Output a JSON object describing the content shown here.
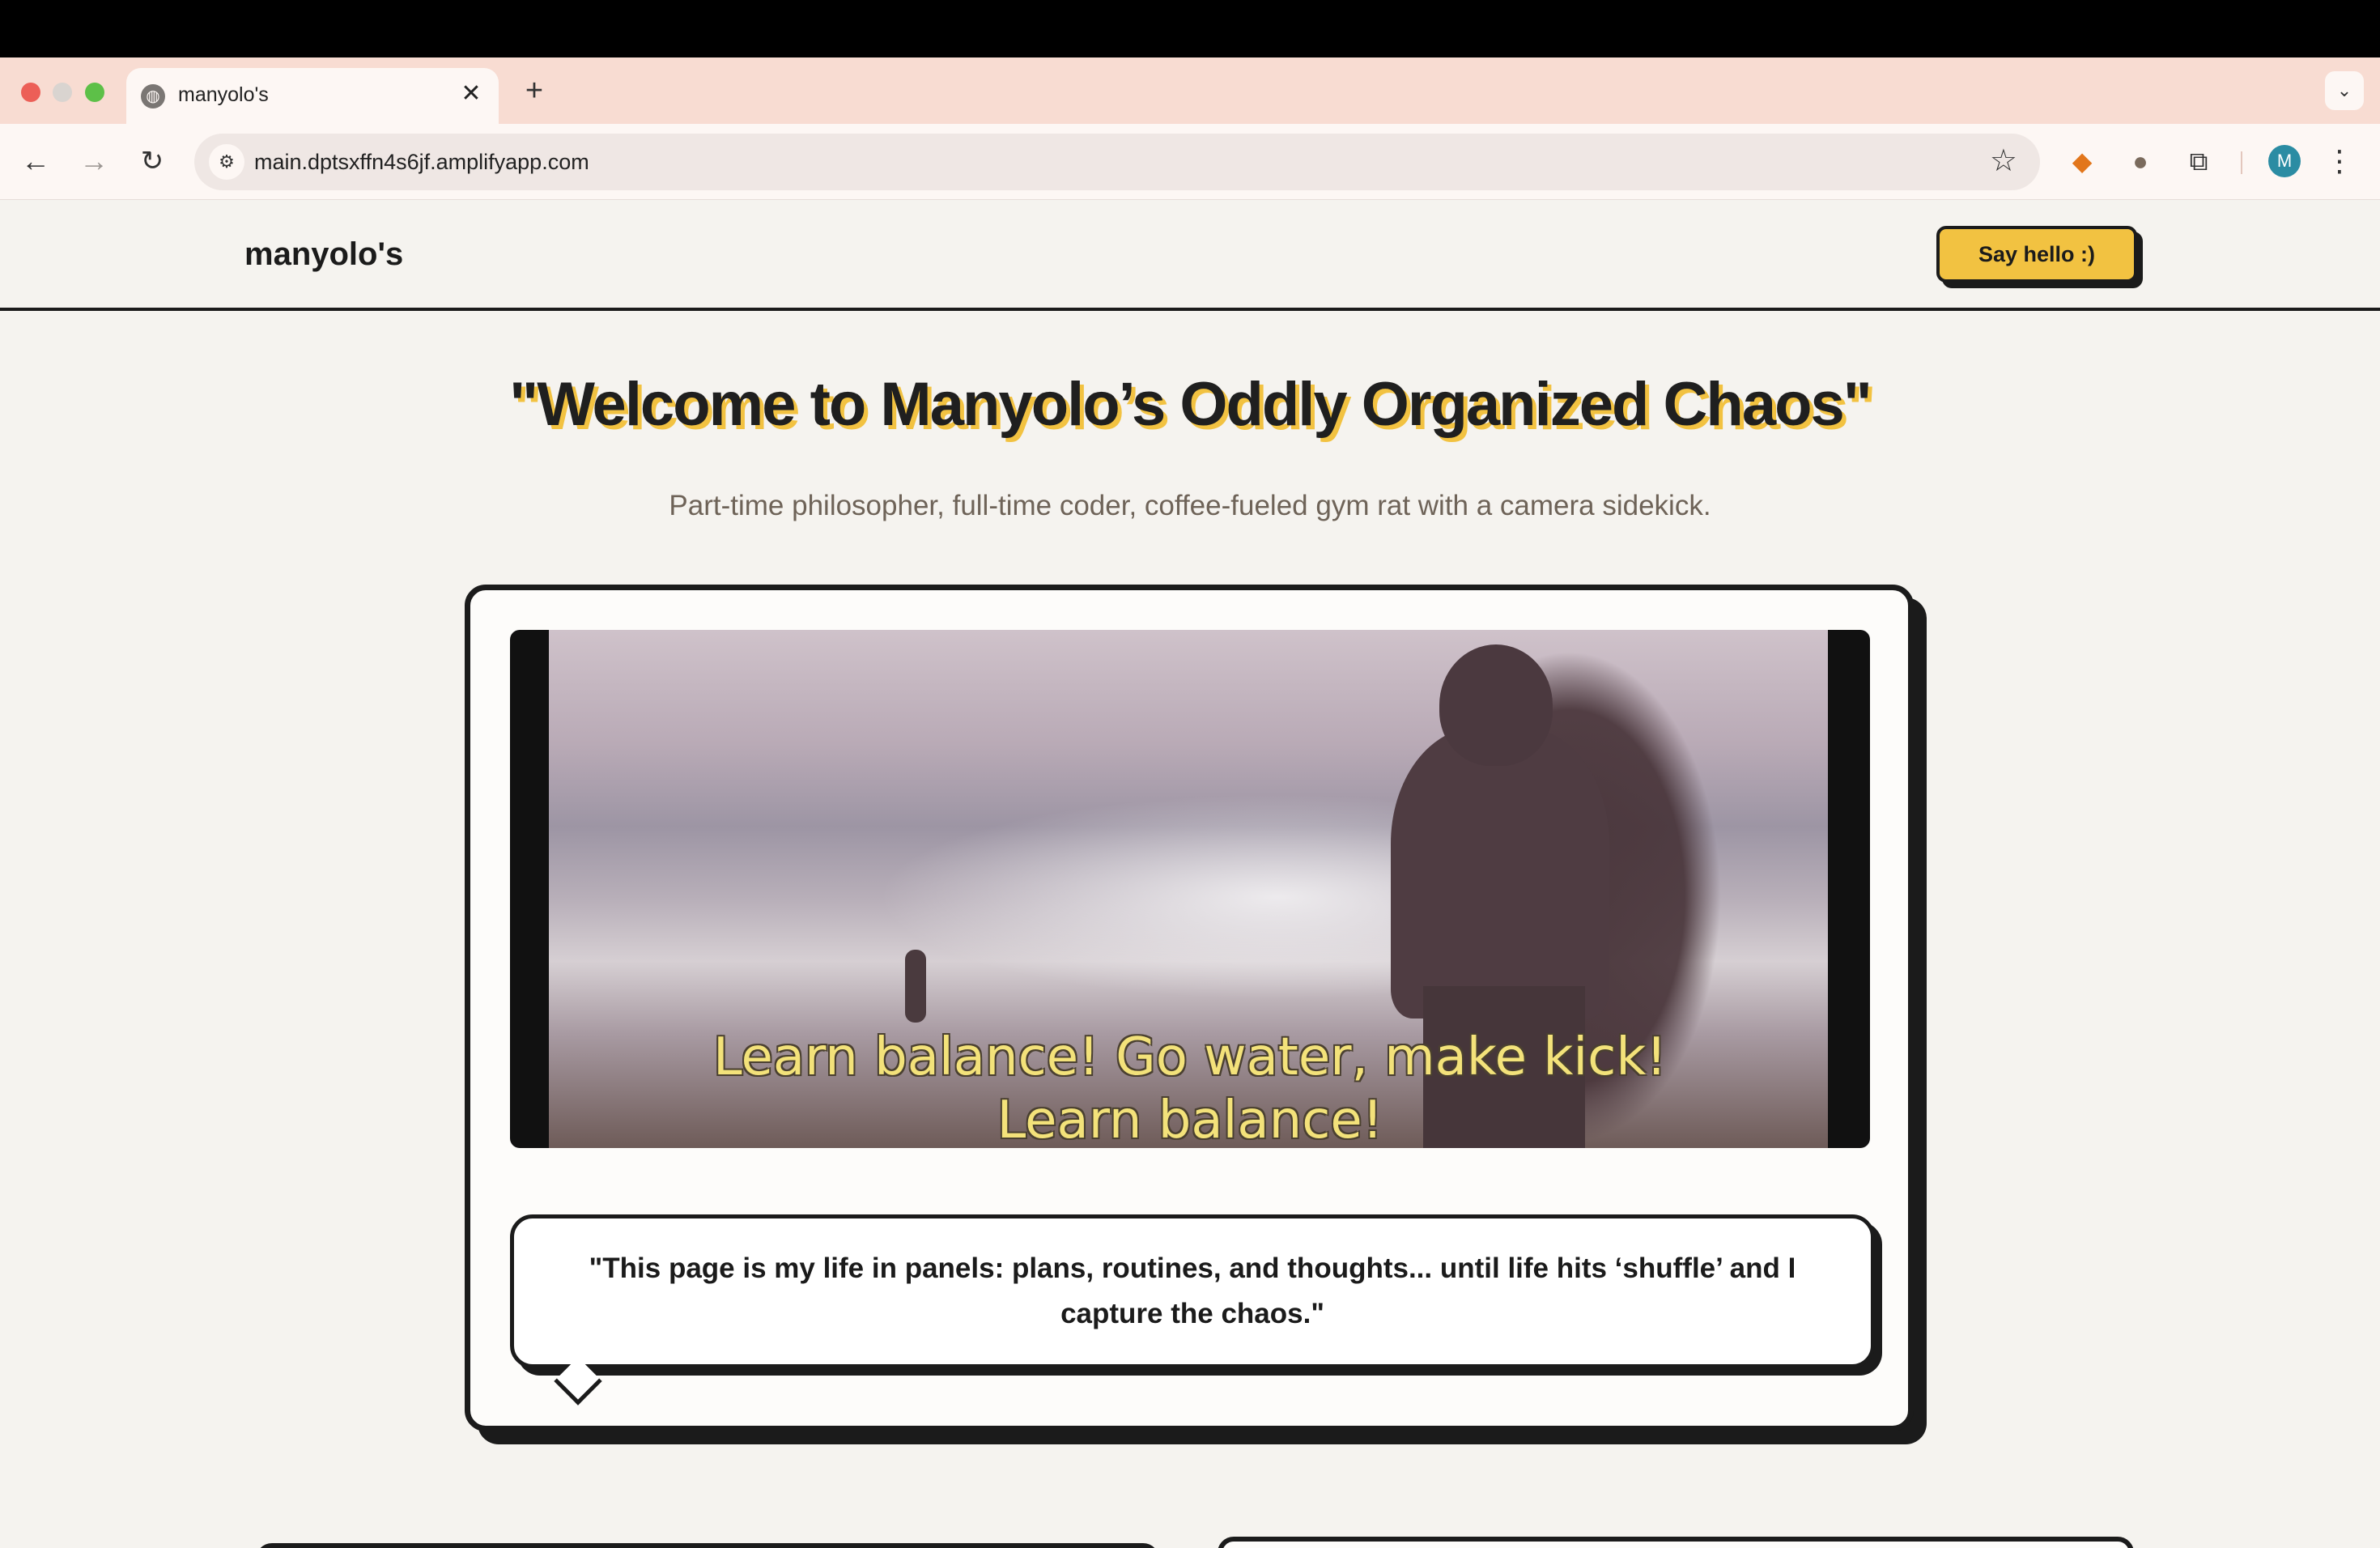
{
  "browser": {
    "tab": {
      "title": "manyolo's",
      "favicon": "globe-icon",
      "close_glyph": "✕"
    },
    "new_tab_glyph": "+",
    "tab_search_glyph": "⌄",
    "address_bar": {
      "url": "main.dptsxffn4s6jf.amplifyapp.com"
    },
    "nav": {
      "back": "←",
      "forward": "→",
      "reload": "↻"
    },
    "extensions": [
      "fox-extension-icon",
      "owl-extension-icon",
      "puzzle-extensions-icon"
    ],
    "profile_initial": "M",
    "menu_glyph": "⋮"
  },
  "site": {
    "brand": "manyolo's",
    "cta_label": "Say hello :)",
    "accent_color": "#f2c241",
    "ink_color": "#1b1b1b"
  },
  "hero": {
    "title": "\"Welcome to Manyolo’s Oddly Organized Chaos\"",
    "subtitle": "Part-time philosopher, full-time coder, coffee-fueled gym rat with a camera sidekick."
  },
  "video": {
    "subtitle_line1": "Learn balance! Go water, make kick!",
    "subtitle_line2": "Learn balance!"
  },
  "quote": {
    "text": "\"This page is my life in panels: plans, routines, and thoughts... until life hits ‘shuffle’ and I capture the chaos.\""
  }
}
